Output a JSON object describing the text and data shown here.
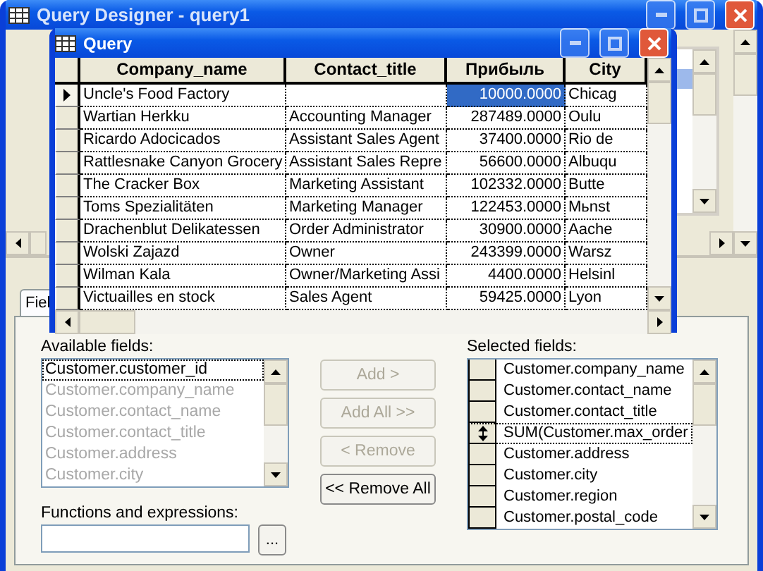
{
  "window": {
    "title": "Query Designer - query1"
  },
  "query_window": {
    "title": "Query",
    "columns": [
      "Company_name",
      "Contact_title",
      "Прибыль",
      "City"
    ],
    "rows": [
      {
        "selected": true,
        "cells": [
          "Uncle's Food Factory",
          "",
          "10000.0000",
          "Chicag"
        ]
      },
      {
        "selected": false,
        "cells": [
          "Wartian Herkku",
          "Accounting Manager",
          "287489.0000",
          "Oulu"
        ]
      },
      {
        "selected": false,
        "cells": [
          "Ricardo Adocicados",
          "Assistant Sales Agent",
          "37400.0000",
          "Rio de"
        ]
      },
      {
        "selected": false,
        "cells": [
          "Rattlesnake Canyon Grocery",
          "Assistant Sales Repre",
          "56600.0000",
          "Albuqu"
        ]
      },
      {
        "selected": false,
        "cells": [
          "The Cracker Box",
          "Marketing Assistant",
          "102332.0000",
          "Butte"
        ]
      },
      {
        "selected": false,
        "cells": [
          "Toms Spezialitäten",
          "Marketing Manager",
          "122453.0000",
          "Mьnst"
        ]
      },
      {
        "selected": false,
        "cells": [
          "Drachenblut Delikatessen",
          "Order Administrator",
          "30900.0000",
          "Aache"
        ]
      },
      {
        "selected": false,
        "cells": [
          "Wolski  Zajazd",
          "Owner",
          "243399.0000",
          "Warsz"
        ]
      },
      {
        "selected": false,
        "cells": [
          "Wilman Kala",
          "Owner/Marketing Assi",
          "4400.0000",
          "Helsinl"
        ]
      },
      {
        "selected": false,
        "cells": [
          "Victuailles en stock",
          "Sales Agent",
          "59425.0000",
          "Lyon"
        ]
      }
    ]
  },
  "tab": {
    "label": "Fiel"
  },
  "available_fields": {
    "label": "Available fields:",
    "items": [
      {
        "label": "Customer.customer_id",
        "selected": true
      },
      {
        "label": "Customer.company_name",
        "selected": false
      },
      {
        "label": "Customer.contact_name",
        "selected": false
      },
      {
        "label": "Customer.contact_title",
        "selected": false
      },
      {
        "label": "Customer.address",
        "selected": false
      },
      {
        "label": "Customer.city",
        "selected": false
      }
    ]
  },
  "functions": {
    "label": "Functions and expressions:",
    "browse_button": "..."
  },
  "buttons": [
    {
      "label": "Add >",
      "disabled": true
    },
    {
      "label": "Add All >>",
      "disabled": true
    },
    {
      "label": "< Remove",
      "disabled": true
    },
    {
      "label": "<< Remove All",
      "disabled": false
    }
  ],
  "selected_fields": {
    "label": "Selected fields:",
    "items": [
      {
        "label": "Customer.company_name",
        "selected": false
      },
      {
        "label": "Customer.contact_name",
        "selected": false
      },
      {
        "label": "Customer.contact_title",
        "selected": false
      },
      {
        "label": "SUM(Customer.max_order",
        "selected": true
      },
      {
        "label": "Customer.address",
        "selected": false
      },
      {
        "label": "Customer.city",
        "selected": false
      },
      {
        "label": "Customer.region",
        "selected": false
      },
      {
        "label": "Customer.postal_code",
        "selected": false
      }
    ]
  }
}
